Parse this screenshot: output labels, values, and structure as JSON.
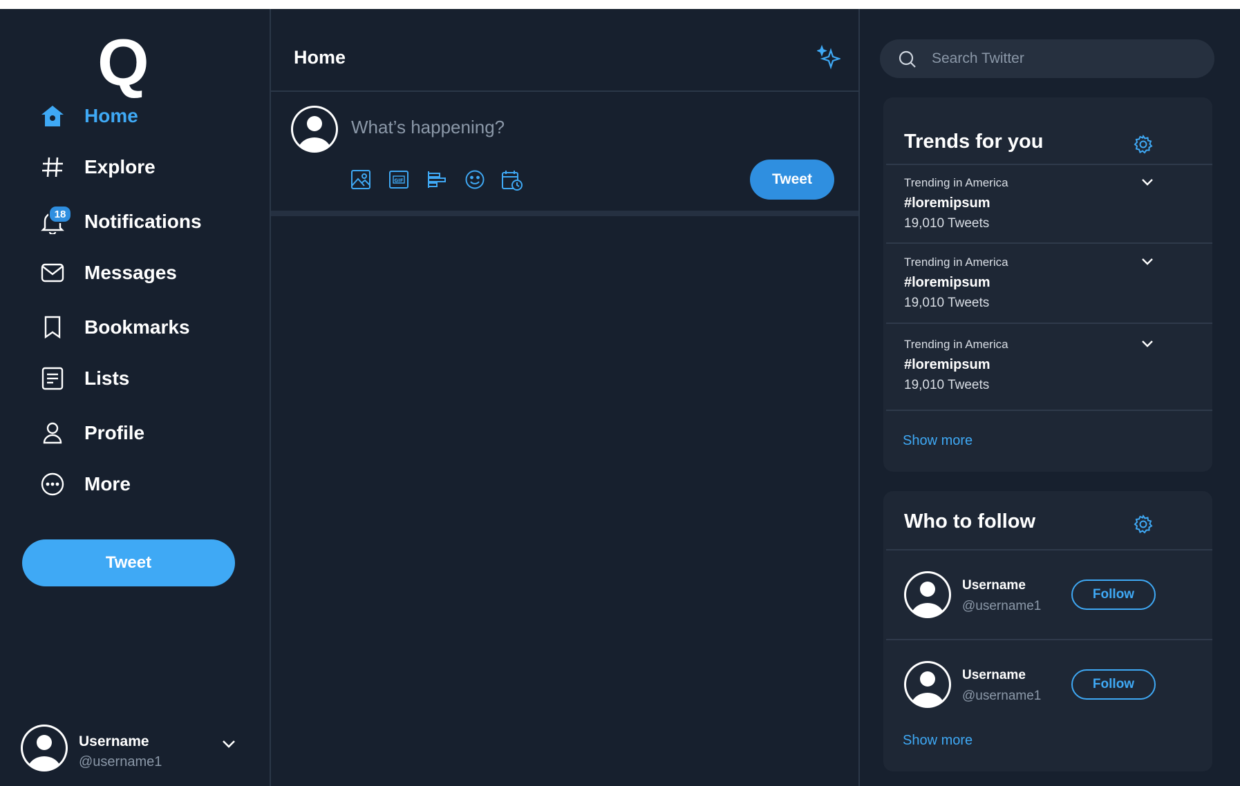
{
  "nav": {
    "logo": "Q",
    "items": [
      {
        "label": "Home",
        "icon": "home-icon"
      },
      {
        "label": "Explore",
        "icon": "hashtag-icon"
      },
      {
        "label": "Notifications",
        "icon": "bell-icon",
        "badge": "18"
      },
      {
        "label": "Messages",
        "icon": "envelope-icon"
      },
      {
        "label": "Bookmarks",
        "icon": "bookmark-icon"
      },
      {
        "label": "Lists",
        "icon": "list-icon"
      },
      {
        "label": "Profile",
        "icon": "person-icon"
      },
      {
        "label": "More",
        "icon": "more-icon"
      }
    ],
    "tweet_button": "Tweet",
    "account": {
      "name": "Username",
      "handle": "@username1"
    }
  },
  "center": {
    "title": "Home",
    "composer": {
      "placeholder": "What’s happening?",
      "tweet_button": "Tweet"
    }
  },
  "search": {
    "placeholder": "Search Twitter"
  },
  "trends": {
    "title": "Trends for you",
    "items": [
      {
        "context": "Trending in America",
        "tag": "#loremipsum",
        "count": "19,010 Tweets"
      },
      {
        "context": "Trending in America",
        "tag": "#loremipsum",
        "count": "19,010 Tweets"
      },
      {
        "context": "Trending in America",
        "tag": "#loremipsum",
        "count": "19,010 Tweets"
      }
    ],
    "show_more": "Show more"
  },
  "who_to_follow": {
    "title": "Who to follow",
    "users": [
      {
        "name": "Username",
        "handle": "@username1",
        "button": "Follow"
      },
      {
        "name": "Username",
        "handle": "@username1",
        "button": "Follow"
      }
    ],
    "show_more": "Show more"
  },
  "colors": {
    "background": "#17202e",
    "accent": "#3fa9f5",
    "card": "#1e2735"
  }
}
